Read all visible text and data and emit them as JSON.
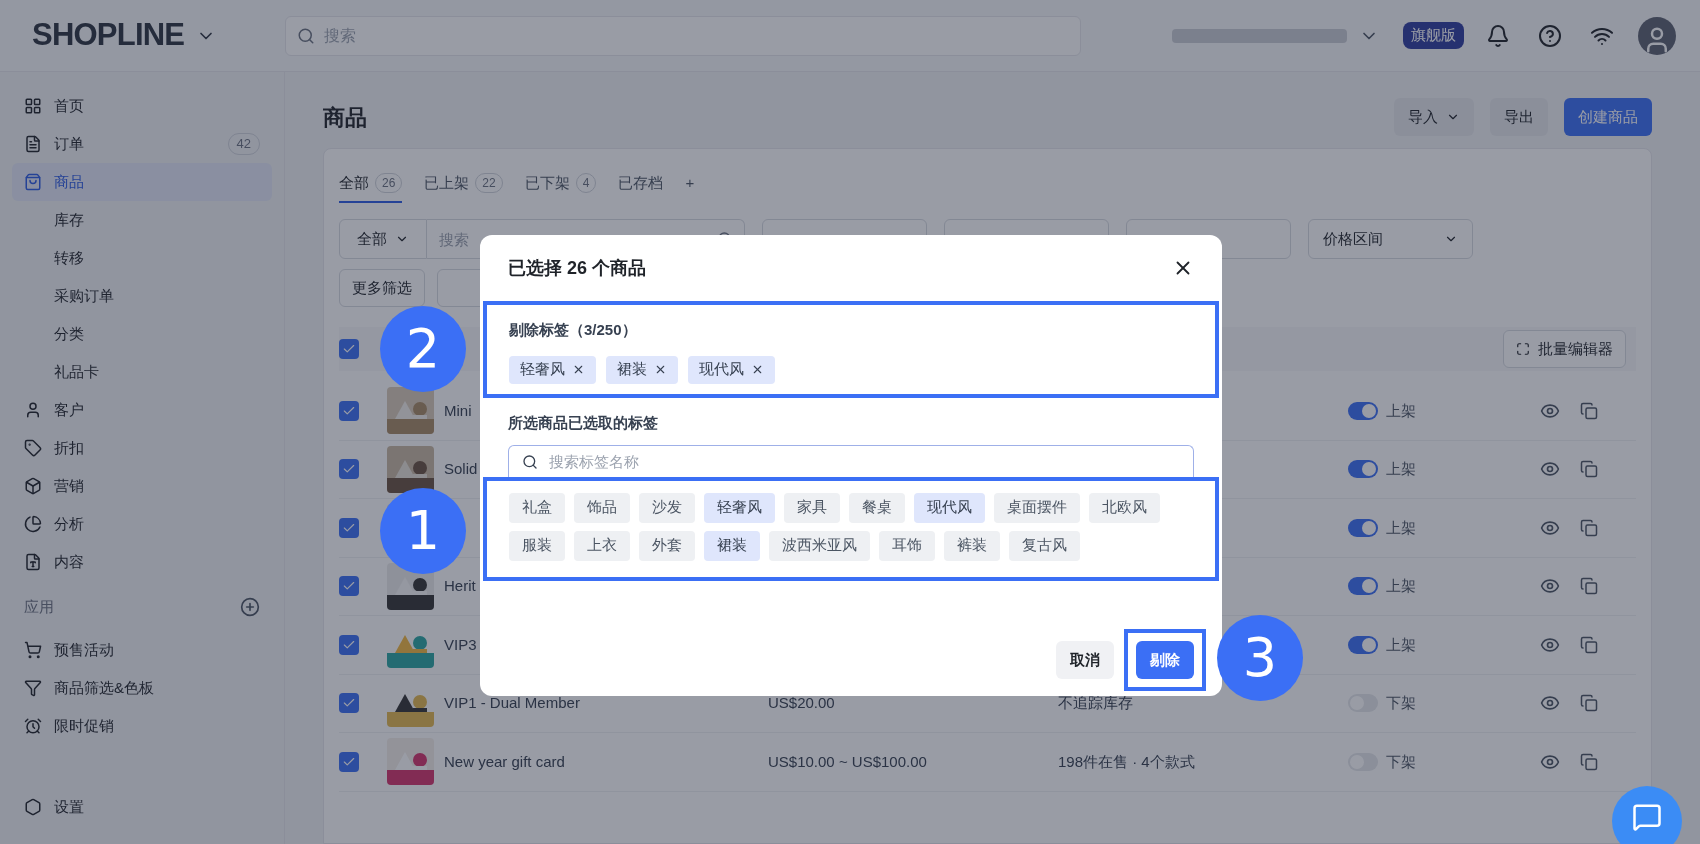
{
  "topbar": {
    "logo": "SHOPLINE",
    "search_placeholder": "搜索",
    "plan_badge": "旗舰版"
  },
  "sidebar": {
    "items": [
      {
        "label": "首页",
        "selected": false
      },
      {
        "label": "订单",
        "badge": "42",
        "selected": false
      },
      {
        "label": "商品",
        "selected": true,
        "children": [
          {
            "label": "库存"
          },
          {
            "label": "转移"
          },
          {
            "label": "采购订单"
          },
          {
            "label": "分类"
          },
          {
            "label": "礼品卡"
          }
        ]
      },
      {
        "label": "客户",
        "selected": false
      },
      {
        "label": "折扣",
        "selected": false
      },
      {
        "label": "营销",
        "selected": false
      },
      {
        "label": "分析",
        "selected": false
      },
      {
        "label": "内容",
        "selected": false
      }
    ],
    "apps_heading": "应用",
    "apps": [
      {
        "label": "预售活动"
      },
      {
        "label": "商品筛选&色板"
      },
      {
        "label": "限时促销"
      }
    ],
    "settings": "设置"
  },
  "page": {
    "title": "商品",
    "buttons": [
      {
        "label": "导入",
        "kind": "dropdown"
      },
      {
        "label": "导出",
        "kind": "plain"
      },
      {
        "label": "创建商品",
        "kind": "primary"
      }
    ]
  },
  "tabs": [
    {
      "label": "全部",
      "count": "26",
      "selected": true
    },
    {
      "label": "已上架",
      "count": "22",
      "selected": false
    },
    {
      "label": "已下架",
      "count": "4",
      "selected": false
    },
    {
      "label": "已存档",
      "selected": false
    },
    {
      "label": "+",
      "selected": false
    }
  ],
  "filters": {
    "scope": "全部",
    "search_placeholder": "搜索",
    "price_dropdown": "价格区间",
    "more": "更多筛选"
  },
  "table": {
    "header_checked": true,
    "bulk_editor": "批量编辑器",
    "rows": [
      {
        "name": "Mini",
        "checked": true,
        "on": true,
        "status": "上架"
      },
      {
        "name": "Solid",
        "checked": true,
        "on": true,
        "status": "上架"
      },
      {
        "checked": true,
        "on": true,
        "status": "上架"
      },
      {
        "name": "Herit",
        "checked": true,
        "on": true,
        "status": "上架"
      },
      {
        "name": "VIP3",
        "checked": true,
        "on": true,
        "status": "上架"
      },
      {
        "name": "VIP1 - Dual Member",
        "price": "US$20.00",
        "inventory": "不追踪库存",
        "checked": true,
        "on": false,
        "status": "下架"
      },
      {
        "name": "New year gift card",
        "price": "US$10.00 ~ US$100.00",
        "inventory": "198件在售 · 4个款式",
        "checked": true,
        "on": false,
        "status": "下架"
      }
    ]
  },
  "dialog": {
    "title": "已选择 26 个商品",
    "remove_heading": "剔除标签（3/250）",
    "remove_tags": [
      "轻奢风",
      "裙装",
      "现代风"
    ],
    "existing_heading": "所选商品已选取的标签",
    "search_placeholder": "搜索标签名称",
    "tags": [
      {
        "label": "礼盒",
        "selected": false
      },
      {
        "label": "饰品",
        "selected": false
      },
      {
        "label": "沙发",
        "selected": false
      },
      {
        "label": "轻奢风",
        "selected": true
      },
      {
        "label": "家具",
        "selected": false
      },
      {
        "label": "餐桌",
        "selected": false
      },
      {
        "label": "现代风",
        "selected": true
      },
      {
        "label": "桌面摆件",
        "selected": false
      },
      {
        "label": "北欧风",
        "selected": false
      },
      {
        "label": "服装",
        "selected": false
      },
      {
        "label": "上衣",
        "selected": false
      },
      {
        "label": "外套",
        "selected": false
      },
      {
        "label": "裙装",
        "selected": true
      },
      {
        "label": "波西米亚风",
        "selected": false
      },
      {
        "label": "耳饰",
        "selected": false
      },
      {
        "label": "裤装",
        "selected": false
      },
      {
        "label": "复古风",
        "selected": false
      }
    ],
    "cancel": "取消",
    "confirm": "剔除"
  },
  "annotations": [
    "2",
    "1",
    "3"
  ]
}
